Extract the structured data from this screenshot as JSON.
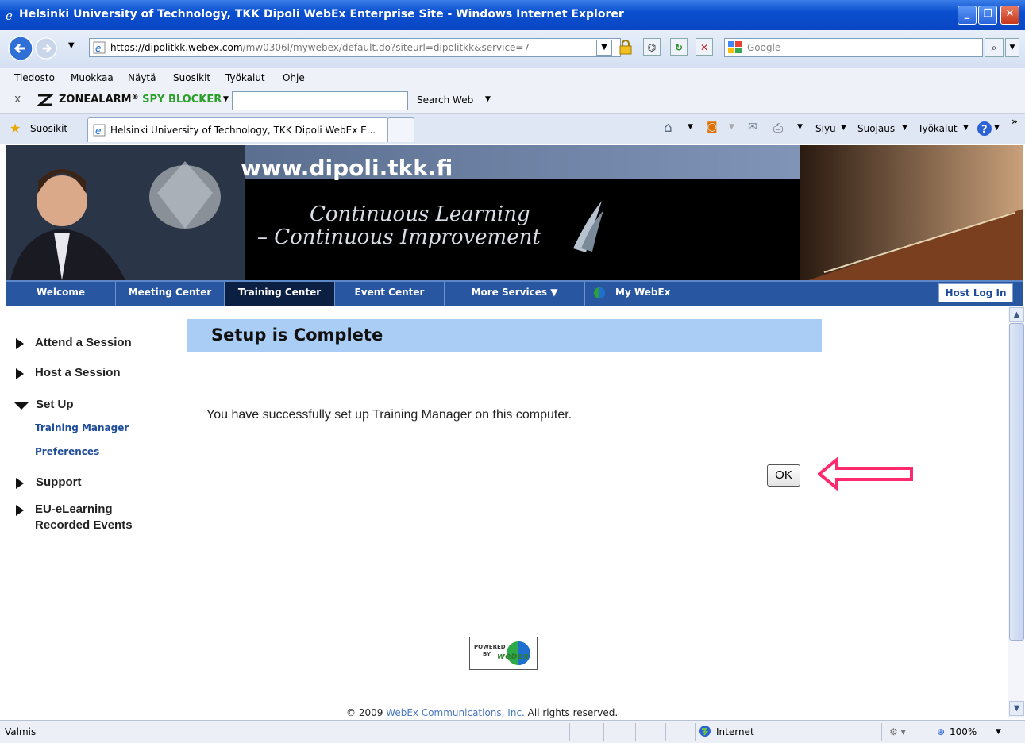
{
  "window": {
    "title": "Helsinki University of Technology, TKK Dipoli WebEx Enterprise Site - Windows Internet Explorer"
  },
  "address": {
    "prefix": "https://dipolitkk.",
    "domain": "webex.com",
    "path": "/mw0306l/mywebex/default.do?siteurl=dipolitkk&service=7"
  },
  "search": {
    "placeholder": "Google"
  },
  "menu": [
    "Tiedosto",
    "Muokkaa",
    "Näytä",
    "Suosikit",
    "Työkalut",
    "Ohje"
  ],
  "toolbar": {
    "close": "x",
    "brand_a": "ZONEALARM",
    "brand_reg": "®",
    "brand_b": "SPY BLOCKER",
    "search_web": "Search Web"
  },
  "tabs": {
    "favorites": "Suosikit",
    "active_tab": "Helsinki University of Technology, TKK Dipoli WebEx E...",
    "siyu": "Siyu",
    "suojaus": "Suojaus",
    "tyokalut": "Työkalut"
  },
  "banner": {
    "url": "www.dipoli.tkk.fi",
    "line1": "Continuous Learning",
    "line2": "– Continuous Improvement"
  },
  "nav": {
    "welcome": "Welcome",
    "meeting": "Meeting Center",
    "training": "Training Center",
    "event": "Event Center",
    "more": "More Services ▼",
    "mywebex": "My WebEx",
    "hostlogin": "Host Log In"
  },
  "sidebar": {
    "attend": "Attend a Session",
    "host": "Host a Session",
    "setup": "Set Up",
    "training_manager": "Training Manager",
    "preferences": "Preferences",
    "support": "Support",
    "eu1": "EU-eLearning",
    "eu2": "Recorded Events"
  },
  "main": {
    "heading": "Setup is Complete",
    "message": "You have successfully set up Training Manager on this computer.",
    "ok": "OK"
  },
  "footer": {
    "powered": "POWERED",
    "by": "BY",
    "webex": "webex",
    "copy_pre": "© 2009 ",
    "copy_link": "WebEx Communications, Inc.",
    "copy_post": " All rights reserved."
  },
  "status": {
    "text": "Valmis",
    "zone": "Internet",
    "zoom": "100%"
  },
  "colors": {
    "heading_bg": "#a9cdf5",
    "nav_bg": "#2856a0",
    "arrow": "#ff2a6d",
    "link": "#1f4d9a"
  }
}
